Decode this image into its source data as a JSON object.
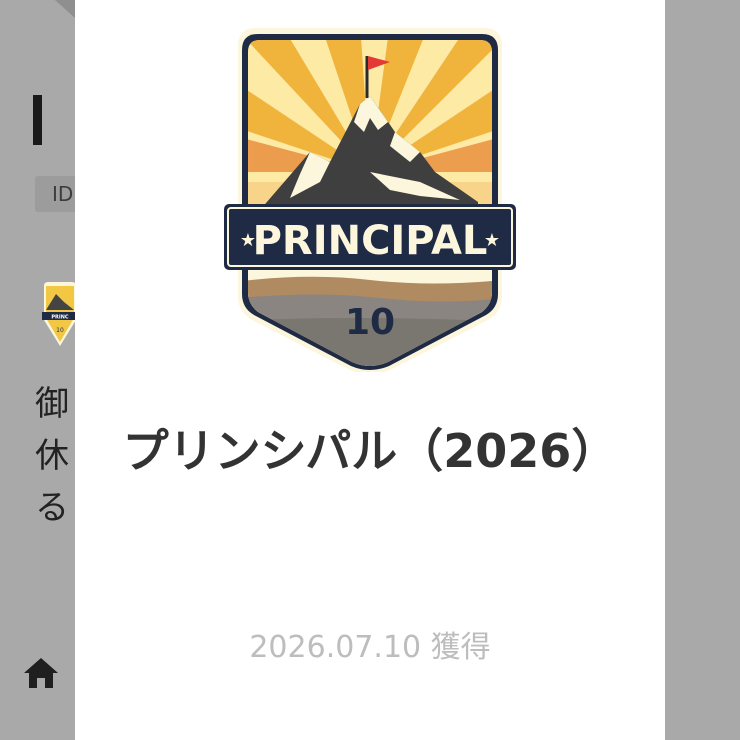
{
  "background": {
    "heading_fragment": "I",
    "id_chip": "ID",
    "text_lines": [
      "御",
      "休",
      "る"
    ]
  },
  "badge": {
    "banner_text": "PRINCIPAL",
    "number": "10",
    "colors": {
      "navy": "#1f2a44",
      "cream": "#fbf6dc",
      "gold": "#f2c744",
      "orange": "#e98f3e",
      "flag": "#e53935"
    }
  },
  "modal": {
    "title": "プリンシパル（2026）",
    "date_text": "2026.07.10 獲得"
  },
  "nav": {
    "home_icon": "home-icon"
  }
}
